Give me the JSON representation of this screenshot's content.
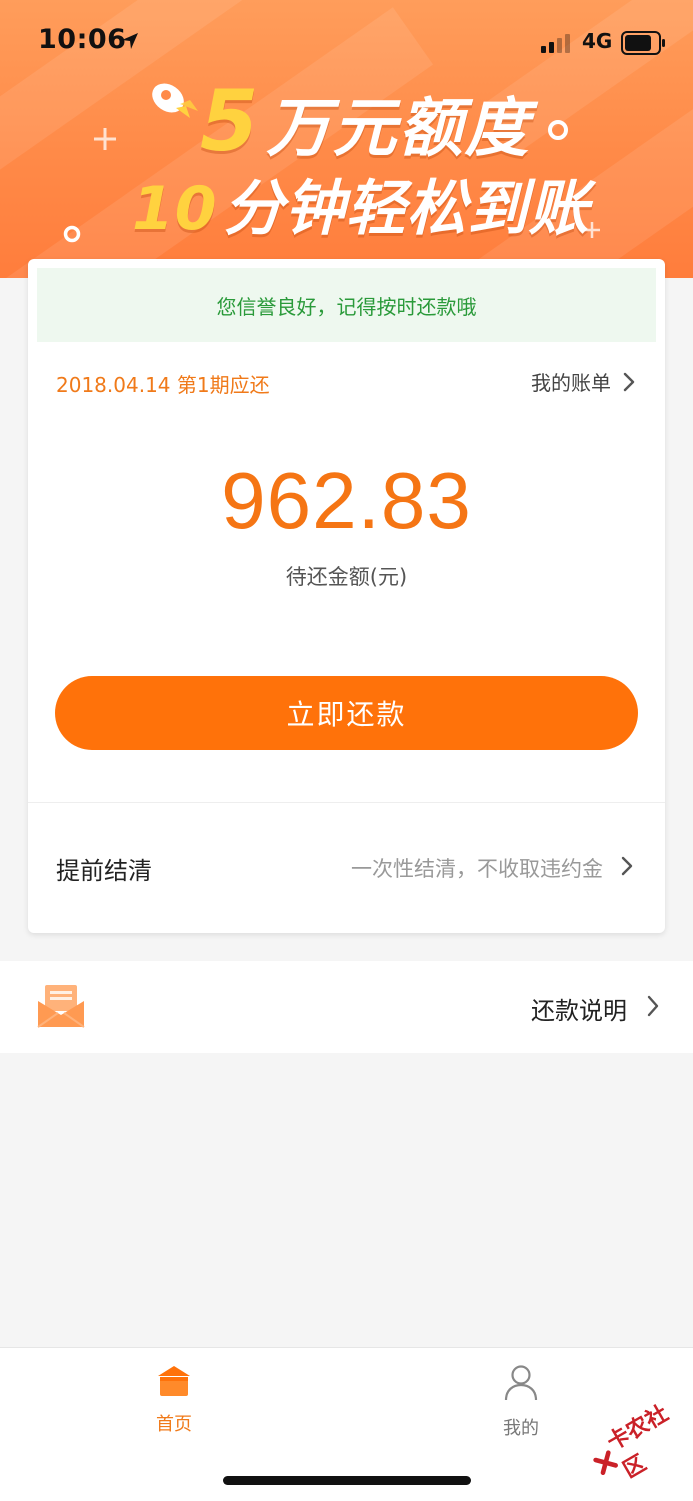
{
  "status_bar": {
    "time": "10:06",
    "network": "4G"
  },
  "banner": {
    "line1_big": "5",
    "line1_rest": "万元额度",
    "line2_big": "10",
    "line2_rest": "分钟轻松到账",
    "icon": "rocket-icon"
  },
  "card": {
    "notice": "您信誉良好，记得按时还款哦",
    "due_date": "2018.04.14 第1期应还",
    "my_bill_label": "我的账单",
    "amount": "962.83",
    "amount_label": "待还金额(元)",
    "repay_button": "立即还款",
    "early_settle": {
      "title": "提前结清",
      "description": "一次性结清，不收取违约金"
    }
  },
  "info_row": {
    "label": "还款说明",
    "icon": "envelope-icon"
  },
  "tabbar": {
    "tabs": [
      {
        "label": "首页",
        "icon": "home-icon",
        "active": true
      },
      {
        "label": "我的",
        "icon": "person-icon",
        "active": false
      }
    ]
  },
  "watermark": "卡农社区",
  "colors": {
    "accent": "#ff720a",
    "amount": "#f57514",
    "notice_text": "#2a9a3a",
    "notice_bg": "#eef8ef"
  }
}
